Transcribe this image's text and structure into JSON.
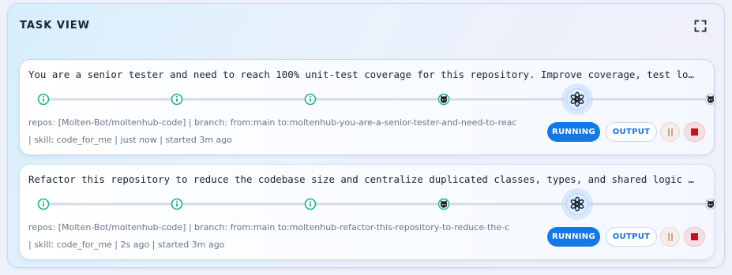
{
  "panel": {
    "title": "TASK VIEW",
    "expand_icon": "expand-icon"
  },
  "tasks": [
    {
      "prompt": "You are a senior tester and need to reach 100% unit-test coverage for this repository. Improve coverage, test lo…",
      "meta_line1": "repos: [Molten-Bot/moltenhub-code]  |  branch: from:main to:moltenhub-you-are-a-senior-tester-and-need-to-reac",
      "meta_line2": "|  skill: code_for_me  |  just now | started 3m ago",
      "status_label": "RUNNING",
      "output_label": "OUTPUT",
      "pause_icon": "pause-icon",
      "stop_icon": "stop-icon",
      "stages": [
        {
          "icon": "info-icon",
          "state": "done"
        },
        {
          "icon": "info-icon",
          "state": "done"
        },
        {
          "icon": "info-icon",
          "state": "done"
        },
        {
          "icon": "github-icon",
          "state": "done"
        },
        {
          "icon": "openai-icon",
          "state": "active"
        },
        {
          "icon": "github-icon",
          "state": "pending"
        }
      ]
    },
    {
      "prompt": "Refactor this repository to reduce the codebase size and centralize duplicated classes, types, and shared logic …",
      "meta_line1": "repos: [Molten-Bot/moltenhub-code]  |  branch: from:main to:moltenhub-refactor-this-repository-to-reduce-the-c",
      "meta_line2": "|  skill: code_for_me  |  2s ago | started 3m ago",
      "status_label": "RUNNING",
      "output_label": "OUTPUT",
      "pause_icon": "pause-icon",
      "stop_icon": "stop-icon",
      "stages": [
        {
          "icon": "info-icon",
          "state": "done"
        },
        {
          "icon": "info-icon",
          "state": "done"
        },
        {
          "icon": "info-icon",
          "state": "done"
        },
        {
          "icon": "github-icon",
          "state": "done"
        },
        {
          "icon": "openai-icon",
          "state": "active"
        },
        {
          "icon": "github-icon",
          "state": "pending"
        }
      ]
    }
  ],
  "colors": {
    "accent": "#1479e5",
    "track_start": "#3cc7d8",
    "track_mid": "#2b7fe6",
    "track_end": "#7a5cd6",
    "track_pending": "#d5dbe8",
    "info_node": "#19b58a",
    "stop": "#c3121e"
  }
}
